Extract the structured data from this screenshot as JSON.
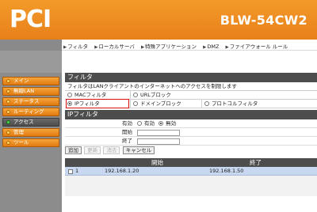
{
  "header": {
    "logo": "PCI",
    "model": "BLW-54CW2"
  },
  "topnav": {
    "items": [
      "フィルタ",
      "ローカルサーバ",
      "特殊アプリケーション",
      "DMZ",
      "ファイアウォール ルール"
    ]
  },
  "sidebar": {
    "items": [
      {
        "label": "メイン",
        "active": false
      },
      {
        "label": "無線LAN",
        "active": false
      },
      {
        "label": "ステータス",
        "active": false
      },
      {
        "label": "ルーティング",
        "active": false
      },
      {
        "label": "アクセス",
        "active": true
      },
      {
        "label": "管理",
        "active": false
      },
      {
        "label": "ツール",
        "active": false
      }
    ]
  },
  "filter": {
    "title": "フィルタ",
    "description": "フィルタはLANクライアントのインターネットへのアクセスを制限します",
    "options": {
      "mac": "MACフィルタ",
      "url": "URLブロック",
      "ip": "IPフィルタ",
      "domain": "ドメインブロック",
      "protocol": "プロトコルフィルタ"
    },
    "selected": "IPフィルタ"
  },
  "ipfilter": {
    "title": "IPフィルタ",
    "enable_label": "有効",
    "enable_on": "有効",
    "enable_off": "無効",
    "enable_selected": "無効",
    "start_label": "開始",
    "end_label": "終了",
    "start_value": "",
    "end_value": ""
  },
  "buttons": {
    "add": "追加",
    "update": "更新",
    "delete": "消去",
    "cancel": "キャンセル"
  },
  "table": {
    "headers": {
      "start": "開始",
      "end": "終了"
    },
    "rows": [
      {
        "index": "1",
        "start": "192.168.1.20",
        "end": "192.168.1.50"
      }
    ]
  }
}
